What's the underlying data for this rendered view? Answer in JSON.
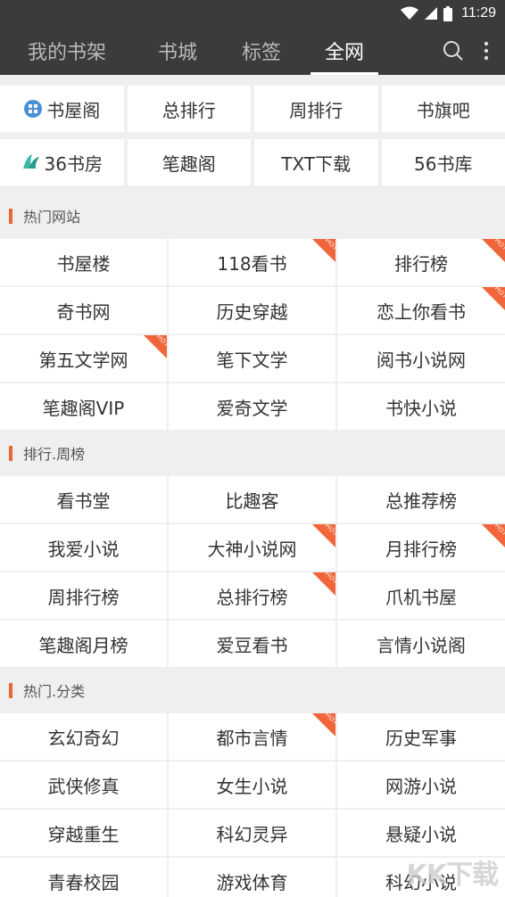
{
  "status_bar": {
    "time": "11:29"
  },
  "tabs": [
    {
      "label": "我的书架"
    },
    {
      "label": "书城"
    },
    {
      "label": "标签"
    },
    {
      "label": "全网",
      "active": true
    }
  ],
  "top_icons": [
    "search-icon",
    "more-vert-icon"
  ],
  "featured": {
    "row1": [
      "书屋阁",
      "总排行",
      "周排行",
      "书旗吧"
    ],
    "row2": [
      "36书房",
      "笔趣阁",
      "TXT下载",
      "56书库"
    ]
  },
  "hot_badge": "HOT",
  "sections": [
    {
      "title": "热门网站",
      "items": [
        {
          "label": "书屋楼",
          "hot": false
        },
        {
          "label": "118看书",
          "hot": true
        },
        {
          "label": "排行榜",
          "hot": true
        },
        {
          "label": "奇书网",
          "hot": false
        },
        {
          "label": "历史穿越",
          "hot": false
        },
        {
          "label": "恋上你看书",
          "hot": true
        },
        {
          "label": "第五文学网",
          "hot": true
        },
        {
          "label": "笔下文学",
          "hot": false
        },
        {
          "label": "阅书小说网",
          "hot": false
        },
        {
          "label": "笔趣阁VIP",
          "hot": false
        },
        {
          "label": "爱奇文学",
          "hot": false
        },
        {
          "label": "书快小说",
          "hot": false
        }
      ]
    },
    {
      "title": "排行.周榜",
      "items": [
        {
          "label": "看书堂",
          "hot": false
        },
        {
          "label": "比趣客",
          "hot": false
        },
        {
          "label": "总推荐榜",
          "hot": false
        },
        {
          "label": "我爱小说",
          "hot": false
        },
        {
          "label": "大神小说网",
          "hot": true
        },
        {
          "label": "月排行榜",
          "hot": true
        },
        {
          "label": "周排行榜",
          "hot": false
        },
        {
          "label": "总排行榜",
          "hot": true
        },
        {
          "label": "爪机书屋",
          "hot": false
        },
        {
          "label": "笔趣阁月榜",
          "hot": false
        },
        {
          "label": "爱豆看书",
          "hot": false
        },
        {
          "label": "言情小说阁",
          "hot": false
        }
      ]
    },
    {
      "title": "热门.分类",
      "items": [
        {
          "label": "玄幻奇幻",
          "hot": false
        },
        {
          "label": "都市言情",
          "hot": true
        },
        {
          "label": "历史军事",
          "hot": false
        },
        {
          "label": "武侠修真",
          "hot": false
        },
        {
          "label": "女生小说",
          "hot": false
        },
        {
          "label": "网游小说",
          "hot": false
        },
        {
          "label": "穿越重生",
          "hot": false
        },
        {
          "label": "科幻灵异",
          "hot": false
        },
        {
          "label": "悬疑小说",
          "hot": false
        },
        {
          "label": "青春校园",
          "hot": false
        },
        {
          "label": "游戏体育",
          "hot": false
        },
        {
          "label": "科幻小说",
          "hot": false
        }
      ]
    }
  ],
  "watermark": "KK下载",
  "colors": {
    "header_bg": "#3b3b3b",
    "accent": "#e8692f",
    "hot_badge": "#f0663a"
  }
}
